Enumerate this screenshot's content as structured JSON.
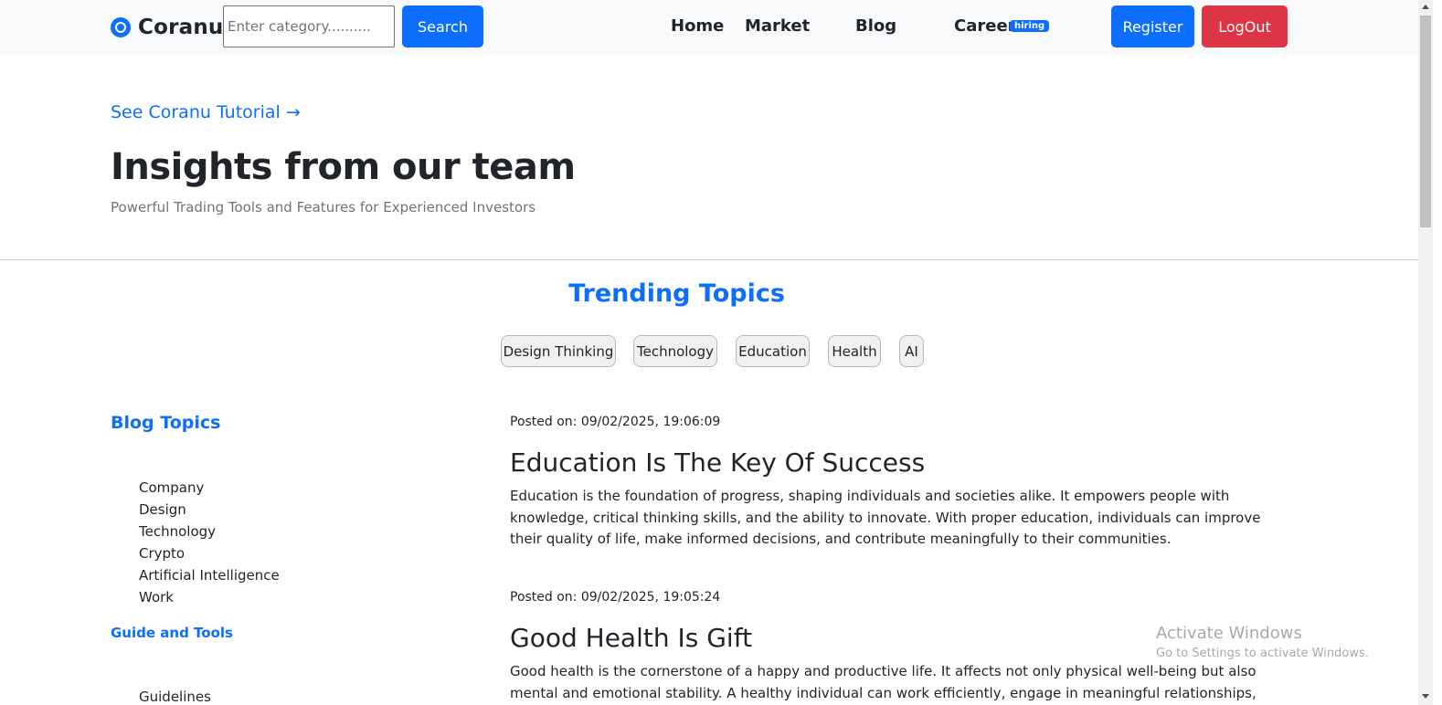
{
  "navbar": {
    "brand": "Coranu",
    "search_placeholder": "Enter category..........",
    "search_label": "Search",
    "links": [
      "Home",
      "Market",
      "Blog",
      "Career"
    ],
    "career_badge": "hiring",
    "register_label": "Register",
    "logout_label": "LogOut"
  },
  "hero": {
    "tutorial_link": "See Coranu Tutorial →",
    "title": "Insights from our team",
    "subtitle": "Powerful Trading Tools and Features for Experienced Investors"
  },
  "trending": {
    "title": "Trending Topics",
    "topics": [
      "Design Thinking",
      "Technology",
      "Education",
      "Health",
      "AI"
    ]
  },
  "sidebar": {
    "title": "Blog Topics",
    "items": [
      "Company",
      "Design",
      "Technology",
      "Crypto",
      "Artificial Intelligence",
      "Work"
    ],
    "guide_title": "Guide and Tools",
    "guide_items": [
      "Guidelines"
    ]
  },
  "posts": [
    {
      "date": "Posted on: 09/02/2025, 19:06:09",
      "title": "Education Is The Key Of Success",
      "body": "Education is the foundation of progress, shaping individuals and societies alike. It empowers people with knowledge, critical thinking skills, and the ability to innovate. With proper education, individuals can improve their quality of life, make informed decisions, and contribute meaningfully to their communities."
    },
    {
      "date": "Posted on: 09/02/2025, 19:05:24",
      "title": "Good Health Is Gift",
      "body": "Good health is the cornerstone of a happy and productive life. It affects not only physical well-being but also mental and emotional stability. A healthy individual can work efficiently, engage in meaningful relationships, and contribute positively"
    }
  ],
  "overlay": {
    "activate_title": "Activate Windows",
    "activate_sub": "Go to Settings to activate Windows."
  },
  "colors": {
    "primary": "#0d6efd",
    "danger": "#dc3545",
    "navbar_bg": "#f8f9fa",
    "muted": "#6c757d"
  }
}
